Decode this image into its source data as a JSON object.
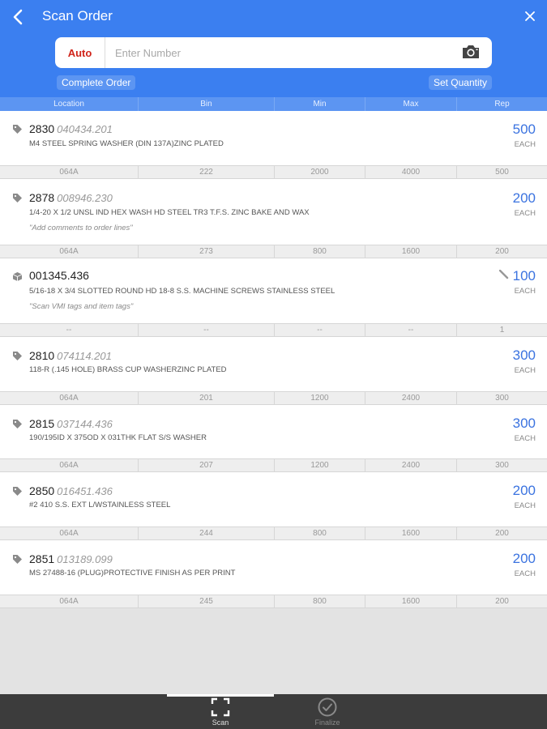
{
  "header": {
    "title": "Scan Order",
    "back_icon": "chevron-left-icon",
    "close_icon": "close-icon"
  },
  "search": {
    "mode_label": "Auto",
    "placeholder": "Enter Number",
    "camera_icon": "camera-icon"
  },
  "actions": {
    "complete_order": "Complete Order",
    "set_quantity": "Set Quantity"
  },
  "columns": [
    "Location",
    "Bin",
    "Min",
    "Max",
    "Rep"
  ],
  "items": [
    {
      "icon": "tag-icon",
      "number": "2830",
      "sku": "040434.201",
      "description": "M4 STEEL SPRING WASHER (DIN 137A)ZINC PLATED",
      "comment": "",
      "qty": "500",
      "unit": "EACH",
      "details": [
        "064A",
        "222",
        "2000",
        "4000",
        "500"
      ]
    },
    {
      "icon": "tag-icon",
      "number": "2878",
      "sku": "008946.230",
      "description": "1/4-20 X 1/2 UNSL IND HEX WASH HD STEEL TR3 T.F.S. ZINC BAKE AND WAX",
      "comment": "\"Add comments to order lines\"",
      "qty": "200",
      "unit": "EACH",
      "details": [
        "064A",
        "273",
        "800",
        "1600",
        "200"
      ]
    },
    {
      "icon": "box-icon",
      "number": "001345.436",
      "sku": "",
      "description": "5/16-18 X 3/4 SLOTTED ROUND HD 18-8 S.S. MACHINE SCREWS STAINLESS STEEL",
      "comment": "\"Scan VMI tags and item tags\"",
      "qty": "100",
      "unit": "EACH",
      "edited": true,
      "details": [
        "--",
        "--",
        "--",
        "--",
        "1"
      ]
    },
    {
      "icon": "tag-icon",
      "number": "2810",
      "sku": "074114.201",
      "description": "118-R (.145 HOLE) BRASS CUP WASHERZINC PLATED",
      "comment": "",
      "qty": "300",
      "unit": "EACH",
      "details": [
        "064A",
        "201",
        "1200",
        "2400",
        "300"
      ]
    },
    {
      "icon": "tag-icon",
      "number": "2815",
      "sku": "037144.436",
      "description": "190/195ID X 375OD X 031THK FLAT S/S WASHER",
      "comment": "",
      "qty": "300",
      "unit": "EACH",
      "details": [
        "064A",
        "207",
        "1200",
        "2400",
        "300"
      ]
    },
    {
      "icon": "tag-icon",
      "number": "2850",
      "sku": "016451.436",
      "description": "#2 410 S.S. EXT L/WSTAINLESS STEEL",
      "comment": "",
      "qty": "200",
      "unit": "EACH",
      "details": [
        "064A",
        "244",
        "800",
        "1600",
        "200"
      ]
    },
    {
      "icon": "tag-icon",
      "number": "2851",
      "sku": "013189.099",
      "description": "MS 27488-16 (PLUG)PROTECTIVE FINISH AS PER PRINT",
      "comment": "",
      "qty": "200",
      "unit": "EACH",
      "details": [
        "064A",
        "245",
        "800",
        "1600",
        "200"
      ]
    }
  ],
  "bottom_nav": {
    "tabs": [
      {
        "label": "Scan",
        "icon": "scan-frame-icon",
        "active": true
      },
      {
        "label": "Finalize",
        "icon": "check-circle-icon",
        "active": false
      }
    ]
  },
  "colors": {
    "header_blue": "#3b7ff0",
    "accent_blue": "#3b73e0",
    "auto_red": "#d0241a",
    "bottom_bar": "#3c3c3c"
  }
}
